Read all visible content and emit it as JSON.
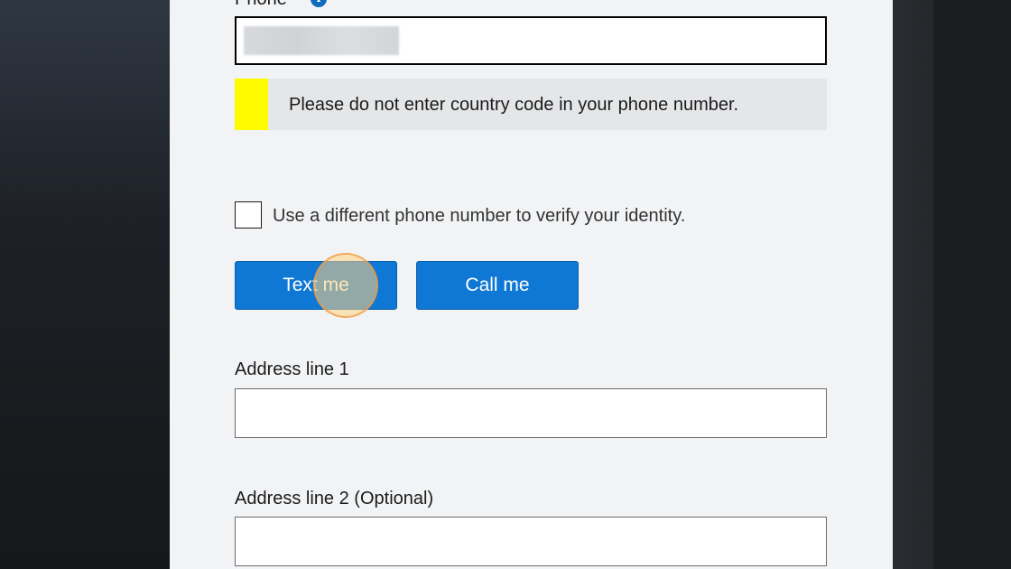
{
  "form": {
    "phone_label": "Phone",
    "notice_text": "Please do not enter country code in your phone number.",
    "checkbox_label": "Use a different phone number to verify your identity.",
    "text_me_label": "Text me",
    "call_me_label": "Call me",
    "address1_label": "Address line 1",
    "address2_label": "Address line 2 (Optional)",
    "address1_value": "",
    "address2_value": ""
  },
  "colors": {
    "accent": "#0f78d4",
    "notice_bar": "#fffb00"
  },
  "icons": {
    "info": "info-icon"
  }
}
